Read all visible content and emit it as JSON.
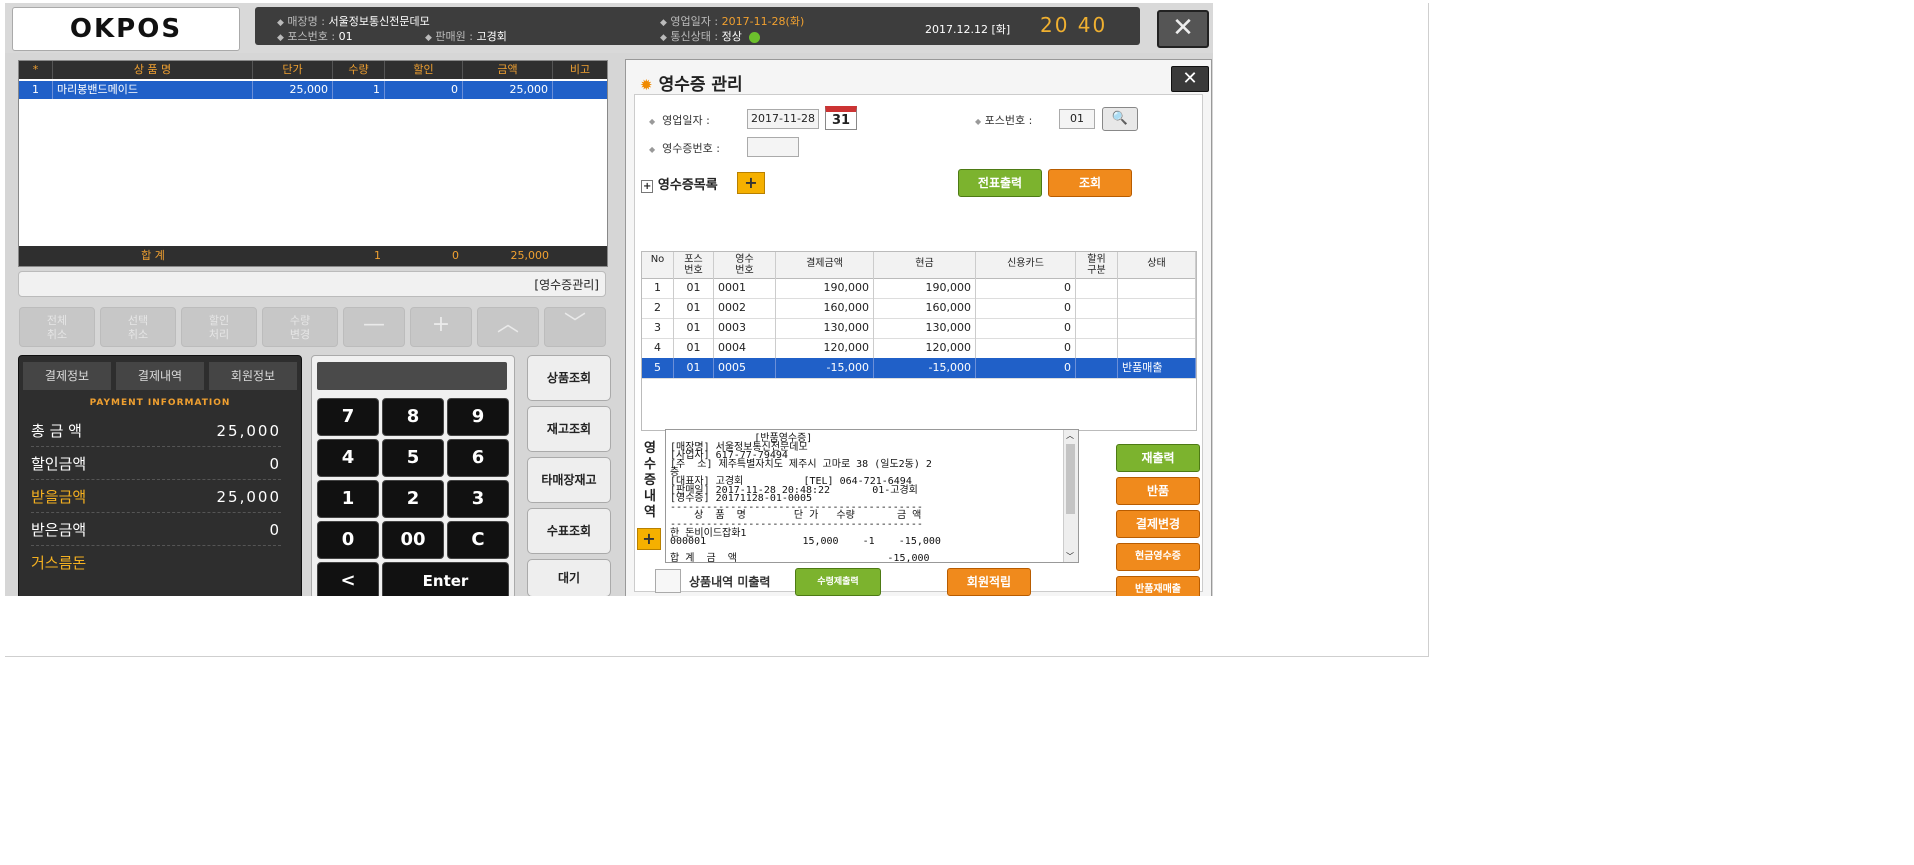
{
  "header": {
    "logo_text": "OKPOS",
    "store_label": "매장명",
    "store_value": "서울정보통신전문데모",
    "pos_label": "포스번호",
    "pos_value": "01",
    "seller_label": "판매원",
    "seller_value": "고경회",
    "sales_date_label": "영업일자",
    "sales_date_value": "2017-11-28(화)",
    "comm_label": "통신상태",
    "comm_value": "정상",
    "clock_date": "2017.12.12 [화]",
    "clock_time": "20  40",
    "close_symbol": "✕"
  },
  "order": {
    "columns": [
      "*",
      "상 품 명",
      "단가",
      "수량",
      "할인",
      "금액",
      "비고"
    ],
    "rows": [
      {
        "no": "1",
        "name": "마리봉밴드메이드",
        "price": "25,000",
        "qty": "1",
        "discount": "0",
        "amount": "25,000",
        "note": ""
      }
    ],
    "total_label": "합    계",
    "total_qty": "1",
    "total_discount": "0",
    "total_amount": "25,000"
  },
  "status_strip_text": "[영수증관리]",
  "control_buttons": [
    {
      "label": "전체\n취소"
    },
    {
      "label": "선택\n취소"
    },
    {
      "label": "할인\n처리"
    },
    {
      "label": "수량\n변경"
    },
    {
      "label": "—"
    },
    {
      "label": "+"
    },
    {
      "label": "︿"
    },
    {
      "label": "﹀"
    }
  ],
  "payment": {
    "tabs": [
      "결제정보",
      "결제내역",
      "회원정보"
    ],
    "subtitle": "PAYMENT INFORMATION",
    "total_label": "총 금 액",
    "total_value": "25,000",
    "discount_label": "할인금액",
    "discount_value": "0",
    "receivable_label": "받을금액",
    "receivable_value": "25,000",
    "received_label": "받은금액",
    "received_value": "0",
    "change_label": "거스름돈"
  },
  "keypad": {
    "keys": [
      "7",
      "8",
      "9",
      "4",
      "5",
      "6",
      "1",
      "2",
      "3",
      "0",
      "00",
      "C"
    ],
    "back_key": "<",
    "enter_key": "Enter"
  },
  "side_buttons": [
    "상품조회",
    "재고조회",
    "타매장재고",
    "수표조회",
    "대기"
  ],
  "dialog": {
    "title": "영수증 관리",
    "close_symbol": "✕",
    "sales_date_label": "영업일자 :",
    "sales_date_value": "2017-11-28",
    "calendar_day": "31",
    "pos_label": "포스번호 :",
    "pos_value": "01",
    "receipt_no_label": "영수증번호 :",
    "receipt_no_value": "",
    "list_label": "영수증목록",
    "print_slip_button": "전표출력",
    "query_button": "조회",
    "table_columns": [
      "No",
      "포스\n번호",
      "영수\n번호",
      "결제금액",
      "현금",
      "신용카드",
      "할위\n구분",
      "상태"
    ],
    "rows": [
      {
        "no": "1",
        "pos": "01",
        "receipt": "0001",
        "pay": "190,000",
        "cash": "190,000",
        "card": "0",
        "kind": "",
        "state": ""
      },
      {
        "no": "2",
        "pos": "01",
        "receipt": "0002",
        "pay": "160,000",
        "cash": "160,000",
        "card": "0",
        "kind": "",
        "state": ""
      },
      {
        "no": "3",
        "pos": "01",
        "receipt": "0003",
        "pay": "130,000",
        "cash": "130,000",
        "card": "0",
        "kind": "",
        "state": ""
      },
      {
        "no": "4",
        "pos": "01",
        "receipt": "0004",
        "pay": "120,000",
        "cash": "120,000",
        "card": "0",
        "kind": "",
        "state": ""
      },
      {
        "no": "5",
        "pos": "01",
        "receipt": "0005",
        "pay": "-15,000",
        "cash": "-15,000",
        "card": "0",
        "kind": "",
        "state": "반품매출"
      }
    ],
    "detail_vertical_label": "영\n수\n증\n내\n역",
    "receipt_lines": [
      "              [반품영수증]",
      "[매장명] 서울정보통신전문데모",
      "[사업자] 617-77-79494",
      "[주  소] 제주특별자치도 제주시 고마로 38 (일도2동) 2",
      "층",
      "[대표자] 고경회          [TEL] 064-721-6494",
      "[판매일] 2017-11-28 20:48:22       01-고경회",
      "[영수증] 20171128-01-0005",
      "------------------------------------------",
      "    상  품  명        단 가   수량       금 액",
      "------------------------------------------",
      "한 돈비이드잡화1",
      "000001                15,000    -1    -15,000",
      "",
      "합 계  금  액                         -15,000"
    ],
    "product_print_label": "상품내역 미출력",
    "member_print_button": "수령제출력",
    "member_points_button": "회원적립",
    "reprint_button": "재출력",
    "return_button": "반품",
    "change_payment_button": "결제변경",
    "cash_receipt_button": "현금영수증",
    "return_resale_button": "반품재매출"
  }
}
